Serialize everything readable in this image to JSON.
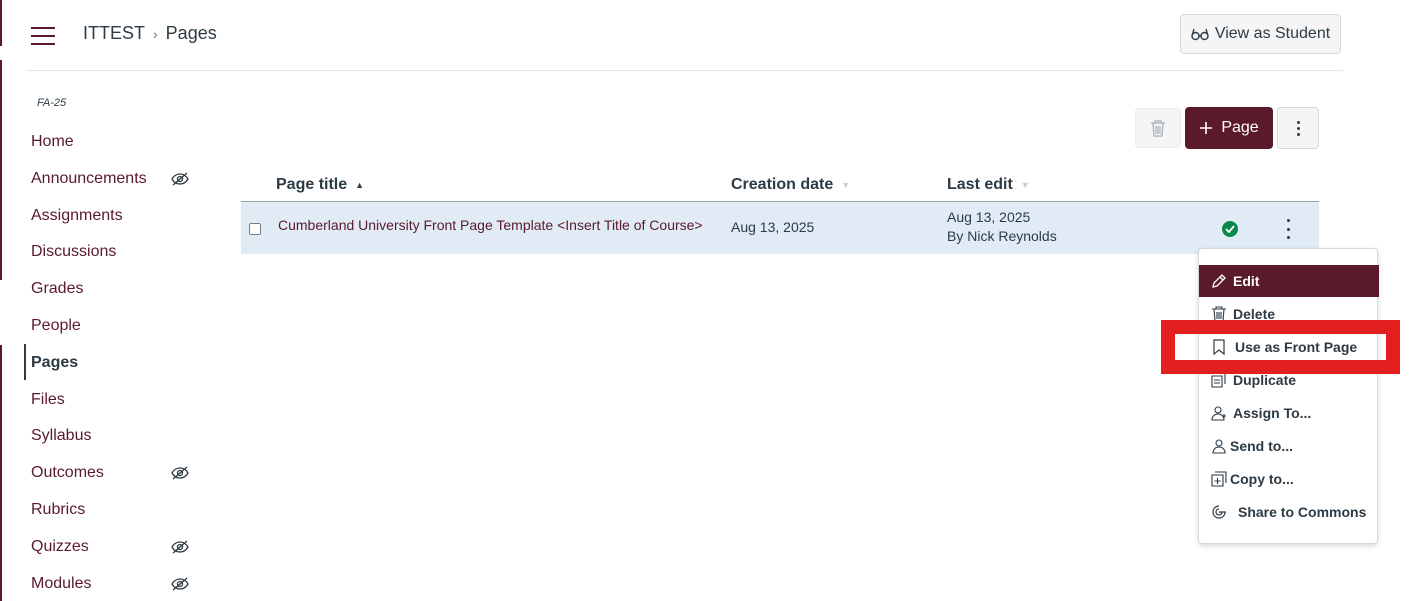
{
  "header": {
    "breadcrumb": [
      "ITTEST",
      "Pages"
    ],
    "view_as_student": "View as Student"
  },
  "sidebar": {
    "term": "FA-25",
    "items": [
      {
        "label": "Home",
        "hidden": false
      },
      {
        "label": "Announcements",
        "hidden": true
      },
      {
        "label": "Assignments",
        "hidden": false
      },
      {
        "label": "Discussions",
        "hidden": false
      },
      {
        "label": "Grades",
        "hidden": false
      },
      {
        "label": "People",
        "hidden": false
      },
      {
        "label": "Pages",
        "hidden": false,
        "active": true
      },
      {
        "label": "Files",
        "hidden": false
      },
      {
        "label": "Syllabus",
        "hidden": false
      },
      {
        "label": "Outcomes",
        "hidden": true
      },
      {
        "label": "Rubrics",
        "hidden": false
      },
      {
        "label": "Quizzes",
        "hidden": true
      },
      {
        "label": "Modules",
        "hidden": true
      }
    ]
  },
  "toolbar": {
    "add_page_label": "Page"
  },
  "table": {
    "columns": [
      {
        "label": "Page title",
        "sort": "asc"
      },
      {
        "label": "Creation date",
        "sort": "none"
      },
      {
        "label": "Last edit",
        "sort": "none"
      }
    ],
    "rows": [
      {
        "title": "Cumberland University Front Page Template <Insert Title of Course>",
        "created": "Aug 13, 2025",
        "last_edit_date": "Aug 13, 2025",
        "last_edit_by": "By Nick Reynolds",
        "published": true
      }
    ]
  },
  "menu": {
    "items": [
      {
        "label": "Edit",
        "icon": "pencil-icon",
        "selected": true
      },
      {
        "label": "Delete",
        "icon": "trash-icon"
      },
      {
        "label": "Use as Front Page",
        "icon": "bookmark-icon"
      },
      {
        "label": "Duplicate",
        "icon": "duplicate-icon"
      },
      {
        "label": "Assign To...",
        "icon": "assign-user-icon"
      },
      {
        "label": "Send to...",
        "icon": "user-icon"
      },
      {
        "label": "Copy to...",
        "icon": "copy-icon"
      },
      {
        "label": "Share to Commons",
        "icon": "commons-icon"
      }
    ]
  },
  "colors": {
    "brand": "#5a1a2a",
    "row_highlight": "#e0ebf5",
    "published": "#0b874b",
    "annotation_red": "#e41f1f"
  }
}
